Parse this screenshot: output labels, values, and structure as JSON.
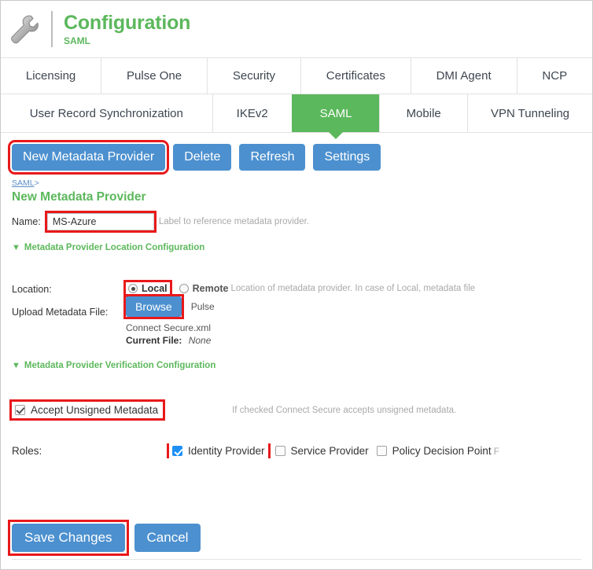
{
  "header": {
    "icon": "wrench-icon",
    "title": "Configuration",
    "subtitle": "SAML",
    "accent_green": "#5cb85c",
    "accent_blue": "#4c90cf",
    "highlight_red": "#e8191b"
  },
  "tabs_row1": [
    {
      "label": "Licensing",
      "active": false
    },
    {
      "label": "Pulse One",
      "active": false
    },
    {
      "label": "Security",
      "active": false
    },
    {
      "label": "Certificates",
      "active": false
    },
    {
      "label": "DMI Agent",
      "active": false
    },
    {
      "label": "NCP",
      "active": false
    }
  ],
  "tabs_row2": [
    {
      "label": "User Record Synchronization",
      "active": false
    },
    {
      "label": "IKEv2",
      "active": false
    },
    {
      "label": "SAML",
      "active": true
    },
    {
      "label": "Mobile",
      "active": false
    },
    {
      "label": "VPN Tunneling",
      "active": false
    }
  ],
  "toolbar": {
    "new_metadata_provider": "New Metadata Provider",
    "delete": "Delete",
    "refresh": "Refresh",
    "settings": "Settings"
  },
  "breadcrumb": {
    "root": "SAML",
    "separator": ">"
  },
  "page_heading": "New Metadata Provider",
  "name_field": {
    "label": "Name:",
    "value": "MS-Azure",
    "placeholder": "",
    "help": "Label to reference metadata provider."
  },
  "location_section": {
    "toggle_caret": "♥",
    "toggle_label": "Metadata Provider Location Configuration",
    "location_label": "Location:",
    "options": [
      {
        "label": "Local",
        "selected": true
      },
      {
        "label": "Remote",
        "selected": false
      }
    ],
    "help": "Location of metadata provider. In case of Local, metadata file",
    "upload_label": "Upload Metadata File:",
    "browse_button": "Browse",
    "selected_file_line1": "Pulse",
    "selected_file_line2": "Connect Secure.xml",
    "current_file_label": "Current File:",
    "current_file_value": "None"
  },
  "verification_section": {
    "toggle_label": "Metadata Provider Verification Configuration",
    "accept_unsigned": {
      "label": "Accept Unsigned Metadata",
      "checked": true,
      "help": "If checked Connect Secure accepts unsigned metadata."
    }
  },
  "roles": {
    "label": "Roles:",
    "options": [
      {
        "label": "Identity Provider",
        "checked": true
      },
      {
        "label": "Service Provider",
        "checked": false
      },
      {
        "label": "Policy Decision Point",
        "checked": false
      }
    ],
    "help_clipped": "F"
  },
  "footer": {
    "save": "Save Changes",
    "cancel": "Cancel"
  }
}
